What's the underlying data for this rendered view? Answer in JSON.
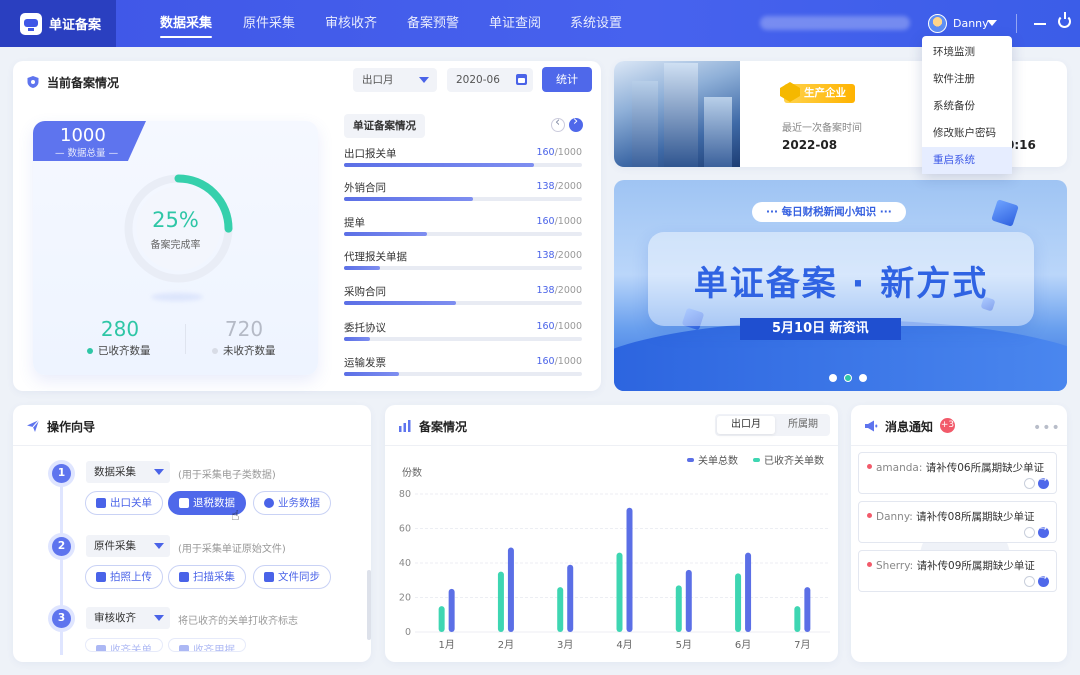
{
  "app": {
    "title": "单证备案",
    "user": "Danny"
  },
  "nav": {
    "tabs": [
      {
        "label": "数据采集"
      },
      {
        "label": "原件采集"
      },
      {
        "label": "审核收齐"
      },
      {
        "label": "备案预警"
      },
      {
        "label": "单证查阅"
      },
      {
        "label": "系统设置"
      }
    ]
  },
  "user_menu": {
    "items": [
      "环境监测",
      "软件注册",
      "系统备份",
      "修改账户密码",
      "重启系统"
    ]
  },
  "filing": {
    "title": "当前备案情况",
    "period_select": "出口月",
    "date_value": "2020-06",
    "stats_button": "统计",
    "total_value": "1000",
    "total_label": "数据总量",
    "progress_percent": "25%",
    "progress_fraction": 0.25,
    "progress_label": "备案完成率",
    "received_value": "280",
    "received_label": "已收齐数量",
    "not_received_value": "720",
    "not_received_label": "未收齐数量",
    "docs_title": "单证备案情况",
    "docs": [
      {
        "name": "出口报关单",
        "done": "160",
        "total": "/1000",
        "ratio": 0.8
      },
      {
        "name": "外销合同",
        "done": "138",
        "total": "/2000",
        "ratio": 0.54
      },
      {
        "name": "提单",
        "done": "160",
        "total": "/1000",
        "ratio": 0.35
      },
      {
        "name": "代理报关单据",
        "done": "138",
        "total": "/2000",
        "ratio": 0.15
      },
      {
        "name": "采购合同",
        "done": "138",
        "total": "/2000",
        "ratio": 0.47
      },
      {
        "name": "委托协议",
        "done": "160",
        "total": "/1000",
        "ratio": 0.11
      },
      {
        "name": "运输发票",
        "done": "160",
        "total": "/1000",
        "ratio": 0.23
      }
    ]
  },
  "enterprise": {
    "badge": "生产企业",
    "last_filing_label": "最近一次备案时间",
    "last_filing_value": "2022-08",
    "last_time_partial": "0:16"
  },
  "banner": {
    "tag": "··· 每日财税新闻小知识 ···",
    "headline": "单证备案 · 新方式",
    "sub": "5月10日 新资讯",
    "active_slide": 2
  },
  "guide": {
    "title": "操作向导",
    "steps": [
      {
        "num": "1",
        "select": "数据采集",
        "hint": "(用于采集电子类数据)",
        "buttons": [
          "出口关单",
          "退税数据",
          "业务数据"
        ]
      },
      {
        "num": "2",
        "select": "原件采集",
        "hint": "(用于采集单证原始文件)",
        "buttons": [
          "拍照上传",
          "扫描采集",
          "文件同步"
        ]
      },
      {
        "num": "3",
        "select": "审核收齐",
        "hint": "将已收齐的关单打收齐标志",
        "buttons": [
          "收齐关单",
          "收齐用据"
        ]
      }
    ]
  },
  "chart_card": {
    "title": "备案情况",
    "tabs": [
      "出口月",
      "所属期"
    ]
  },
  "notifications": {
    "title": "消息通知",
    "count": "+3",
    "items": [
      {
        "who": "amanda:",
        "text": "请补传06所属期缺少单证"
      },
      {
        "who": "Danny:",
        "text": "请补传08所属期缺少单证"
      },
      {
        "who": "Sherry:",
        "text": "请补传09所属期缺少单证"
      }
    ]
  },
  "colors": {
    "primary": "#4f68ea",
    "accent": "#2ec6a6",
    "alert": "#f25a6a"
  },
  "chart_data": {
    "type": "bar",
    "ylabel": "份数",
    "categories": [
      "1月",
      "2月",
      "3月",
      "4月",
      "5月",
      "6月",
      "7月"
    ],
    "ylim": [
      0,
      80
    ],
    "yticks": [
      0,
      20,
      40,
      60,
      80
    ],
    "series": [
      {
        "name": "已收齐关单数",
        "color": "#3ed6b2",
        "values": [
          15,
          35,
          26,
          46,
          27,
          34,
          15
        ]
      },
      {
        "name": "关单总数",
        "color": "#5b6fe6",
        "values": [
          25,
          49,
          39,
          72,
          36,
          46,
          26
        ]
      }
    ],
    "legend_position": "top-right",
    "grid": true
  }
}
